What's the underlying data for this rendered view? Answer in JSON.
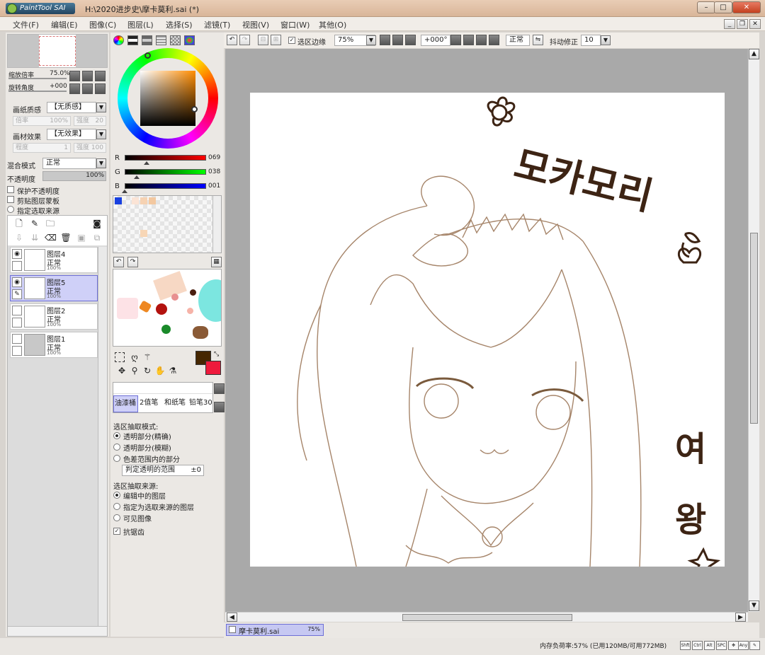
{
  "titlebar": {
    "path": "H:\\2020进步史\\摩卡莫利.sai (*)",
    "logo": "PaintTool SAI"
  },
  "menu": [
    "文件(F)",
    "编辑(E)",
    "图像(C)",
    "图层(L)",
    "选择(S)",
    "滤镜(T)",
    "视图(V)",
    "窗口(W)",
    "其他(O)"
  ],
  "navigator": {
    "zoom_label": "缩放倍率",
    "zoom_value": "75.0%",
    "rotate_label": "旋转角度",
    "rotate_value": "+000"
  },
  "paper_texture": {
    "label": "画纸质感",
    "value": "【无质感】",
    "scale_label": "倍率",
    "scale_value": "100%",
    "strength_label": "强度",
    "strength_value": "20"
  },
  "material_effect": {
    "label": "画材效果",
    "value": "【无效果】",
    "degree_label": "程度",
    "degree_value": "1",
    "strength_label": "强度",
    "strength_value": "100"
  },
  "blend": {
    "label": "混合模式",
    "value": "正常",
    "opacity_label": "不透明度",
    "opacity_value": "100%",
    "opacity_fraction": 1.0
  },
  "layer_options": [
    "保护不透明度",
    "剪贴图层蒙板",
    "指定选取来源"
  ],
  "layers": [
    {
      "name": "图层4",
      "mode": "正常",
      "opacity": "100%",
      "selected": false
    },
    {
      "name": "图层5",
      "mode": "正常",
      "opacity": "100%",
      "selected": true
    },
    {
      "name": "图层2",
      "mode": "正常",
      "opacity": "100%",
      "selected": false
    },
    {
      "name": "图层1",
      "mode": "正常",
      "opacity": "100%",
      "selected": false
    }
  ],
  "rgb": {
    "r": "069",
    "g": "038",
    "b": "001",
    "r_frac": 0.27,
    "g_frac": 0.15,
    "b_frac": 0.004
  },
  "colors": {
    "primary": "#452601",
    "secondary": "#ee1a3c"
  },
  "brushes": [
    "油漆桶",
    "2值笔",
    "和纸笔",
    "铅笔30"
  ],
  "selection_mode": {
    "title": "选区抽取模式:",
    "options": [
      "透明部分(精确)",
      "透明部分(模糊)",
      "色差范围内的部分"
    ],
    "range_label": "判定透明的范围",
    "range_value": "±0"
  },
  "selection_source": {
    "title": "选区抽取来源:",
    "options": [
      "编辑中的图层",
      "指定为选取来源的图层",
      "可见图像"
    ],
    "antialias": "抗锯齿"
  },
  "toolbar": {
    "selection_edge": "选区边缘",
    "zoom": "75%",
    "angle": "+000°",
    "mode": "正常",
    "stabilizer_label": "抖动修正",
    "stabilizer": "10"
  },
  "canvas_text": {
    "line1": "모카모리",
    "line2a": "여",
    "line2b": "왕"
  },
  "tab": {
    "name": "摩卡莫利.sai",
    "zoom": "75%"
  },
  "status": {
    "memory": "内存负荷率:57% (已用120MB/可用772MB)",
    "keys": [
      "Shft",
      "Ctrl",
      "Alt",
      "SPC",
      "Any"
    ]
  }
}
